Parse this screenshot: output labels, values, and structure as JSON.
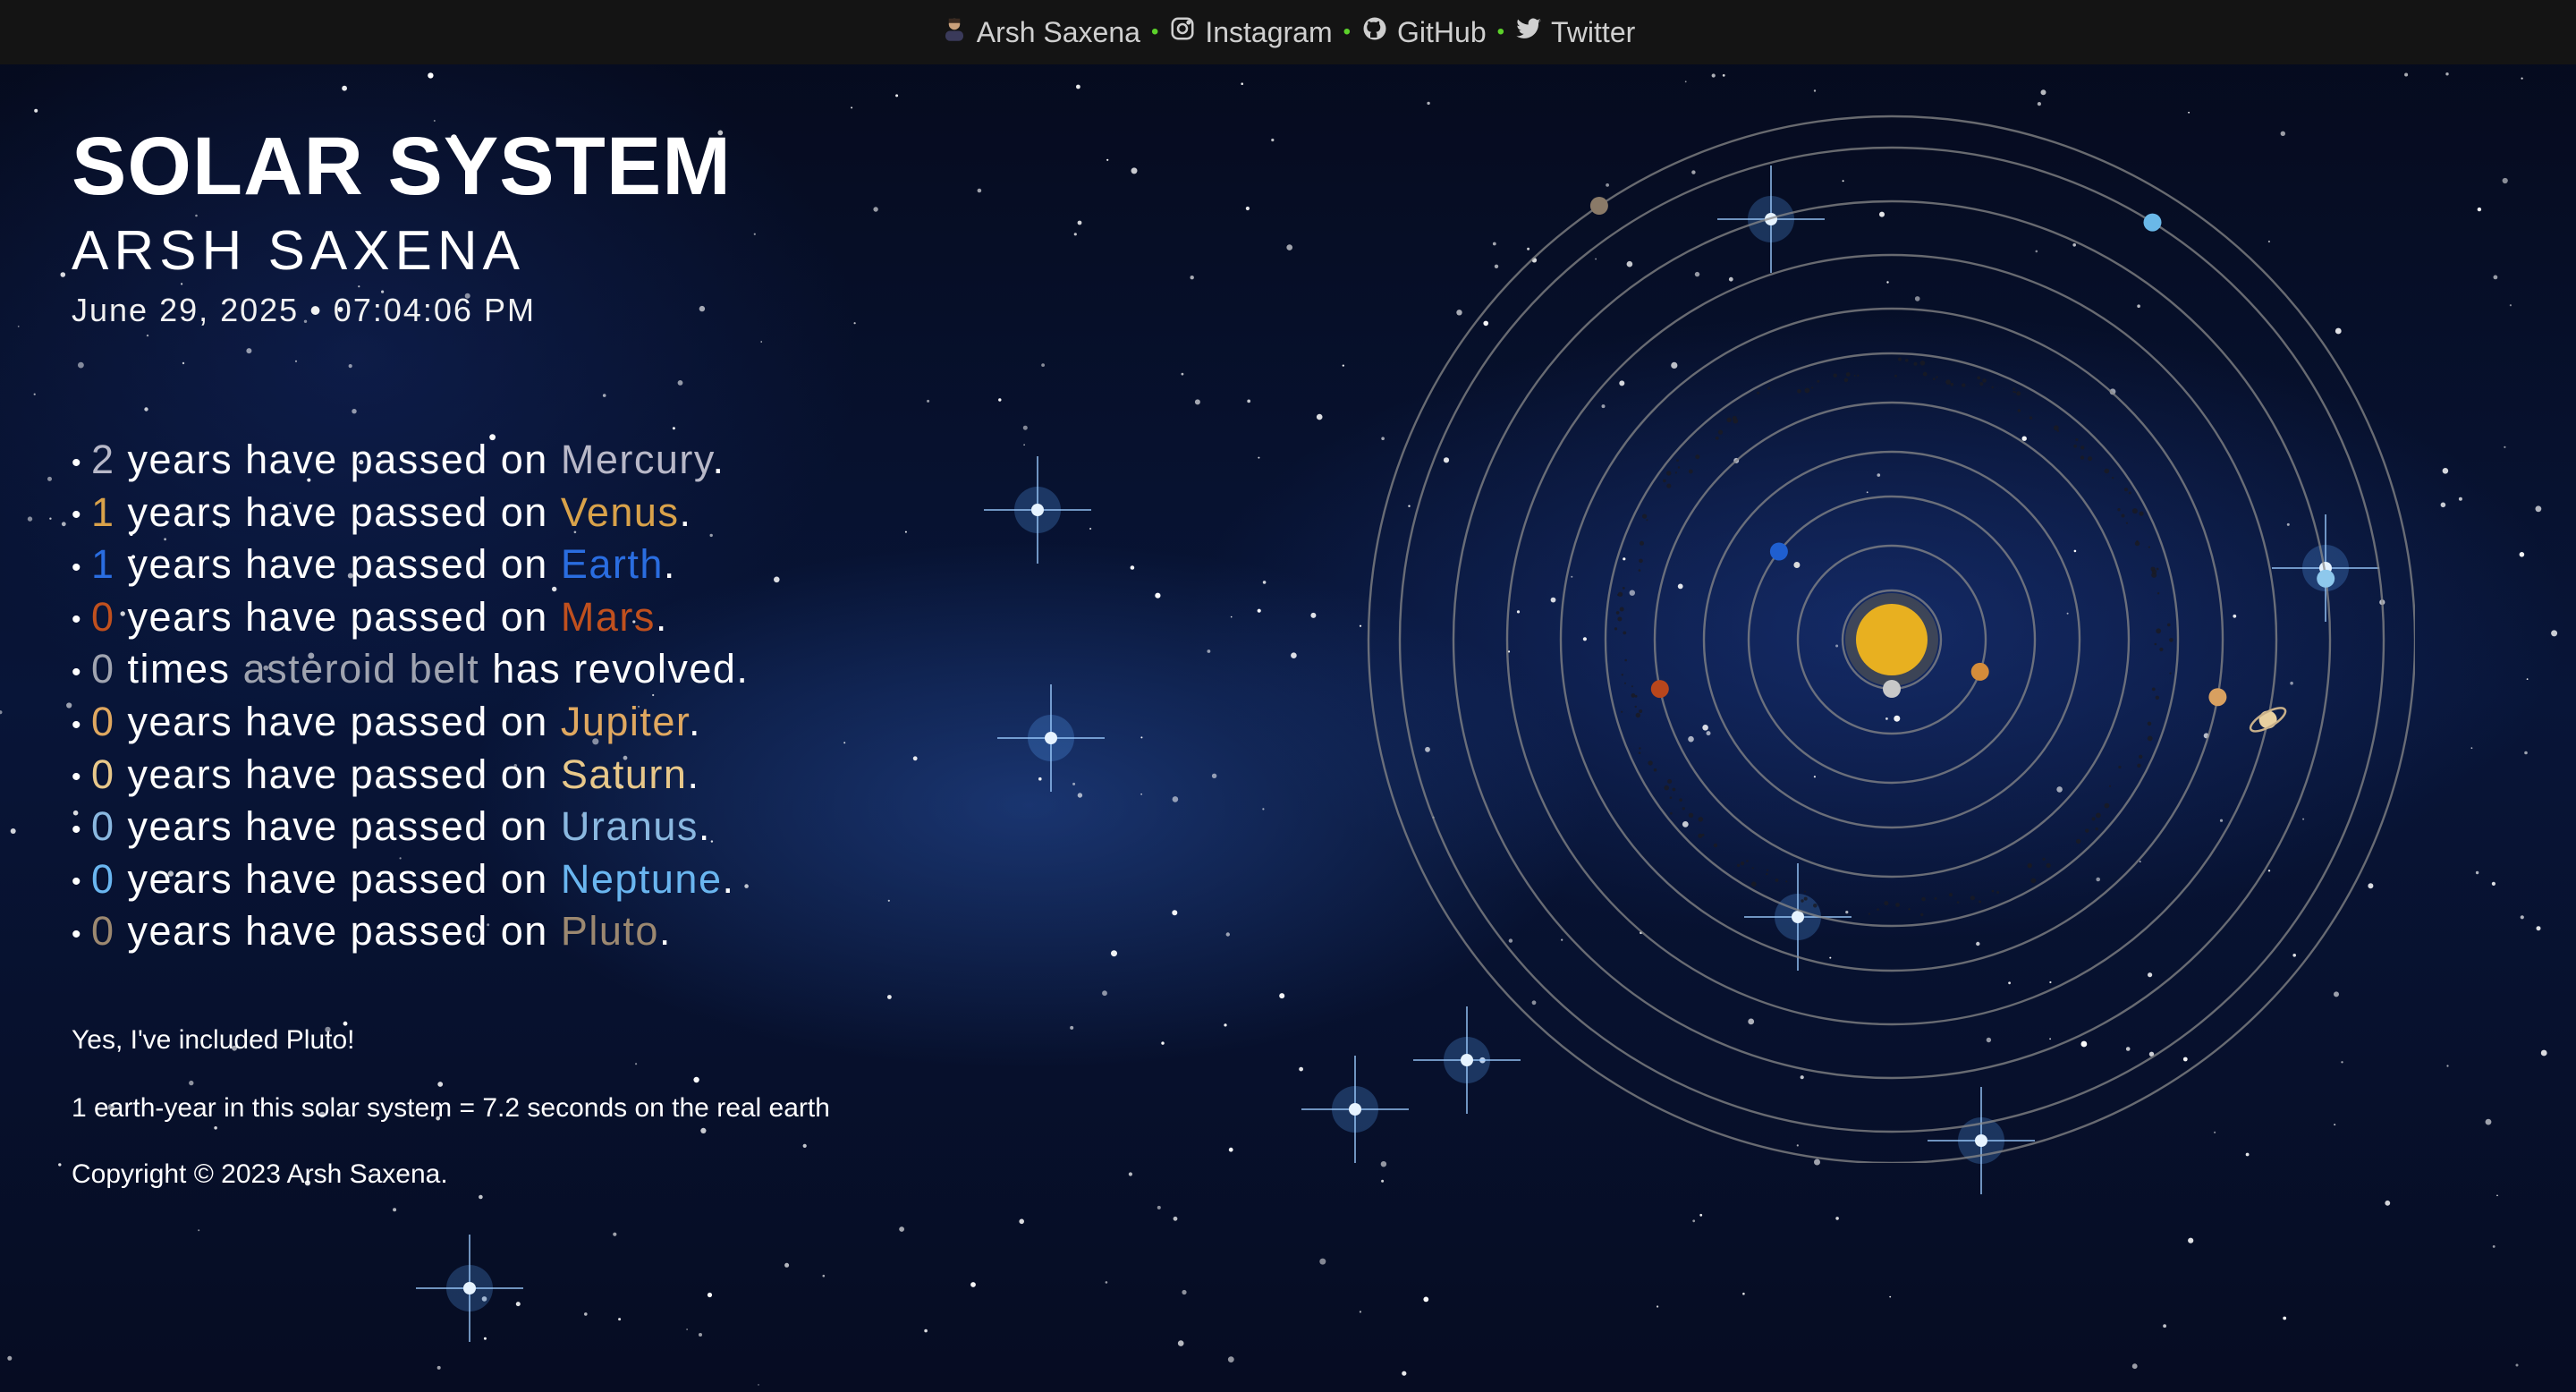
{
  "nav": {
    "items": [
      {
        "label": "Arsh Saxena",
        "icon": "avatar-icon"
      },
      {
        "label": "Instagram",
        "icon": "instagram-icon"
      },
      {
        "label": "GitHub",
        "icon": "github-icon"
      },
      {
        "label": "Twitter",
        "icon": "twitter-icon"
      }
    ],
    "separator": "•",
    "separator_color": "#5cd12a"
  },
  "header": {
    "title": "SOLAR SYSTEM",
    "author": "ARSH SAXENA",
    "datetime": "June 29, 2025 • 07:04:06 PM"
  },
  "stats": [
    {
      "count": "2",
      "pre": " years have passed on ",
      "body": "Mercury",
      "post": ".",
      "color": "#b8b8c8"
    },
    {
      "count": "1",
      "pre": " years have passed on ",
      "body": "Venus",
      "post": ".",
      "color": "#d9a24a"
    },
    {
      "count": "1",
      "pre": " years have passed on ",
      "body": "Earth",
      "post": ".",
      "color": "#2a6de0"
    },
    {
      "count": "0",
      "pre": " years have passed on ",
      "body": "Mars",
      "post": ".",
      "color": "#c0501e"
    },
    {
      "count": "0",
      "pre": " times ",
      "body": "asteroid belt",
      "post": " has revolved.",
      "color": "#a0a4b0"
    },
    {
      "count": "0",
      "pre": " years have passed on ",
      "body": "Jupiter",
      "post": ".",
      "color": "#e0a860"
    },
    {
      "count": "0",
      "pre": " years have passed on ",
      "body": "Saturn",
      "post": ".",
      "color": "#e8c88a"
    },
    {
      "count": "0",
      "pre": " years have passed on ",
      "body": "Uranus",
      "post": ".",
      "color": "#8ab8e0"
    },
    {
      "count": "0",
      "pre": " years have passed on ",
      "body": "Neptune",
      "post": ".",
      "color": "#6ab6f0"
    },
    {
      "count": "0",
      "pre": " years have passed on ",
      "body": "Pluto",
      "post": ".",
      "color": "#9c8870"
    }
  ],
  "footer": {
    "pluto_note": "Yes, I've included Pluto!",
    "scale_note": "1 earth-year in this solar system = 7.2 seconds on the real earth",
    "copyright": "Copyright © 2023 Arsh Saxena."
  },
  "colors": {
    "sun": "#e8b020",
    "orbit": "#8a8a8a",
    "mercury": "#c8c8c8",
    "venus": "#d48c3a",
    "earth": "#1f5fd0",
    "mars": "#b8461c",
    "jupiter": "#d8a060",
    "saturn": "#e8d0a0",
    "uranus": "#8ec8ec",
    "neptune": "#6ab8e8",
    "pluto": "#8a7a68"
  }
}
